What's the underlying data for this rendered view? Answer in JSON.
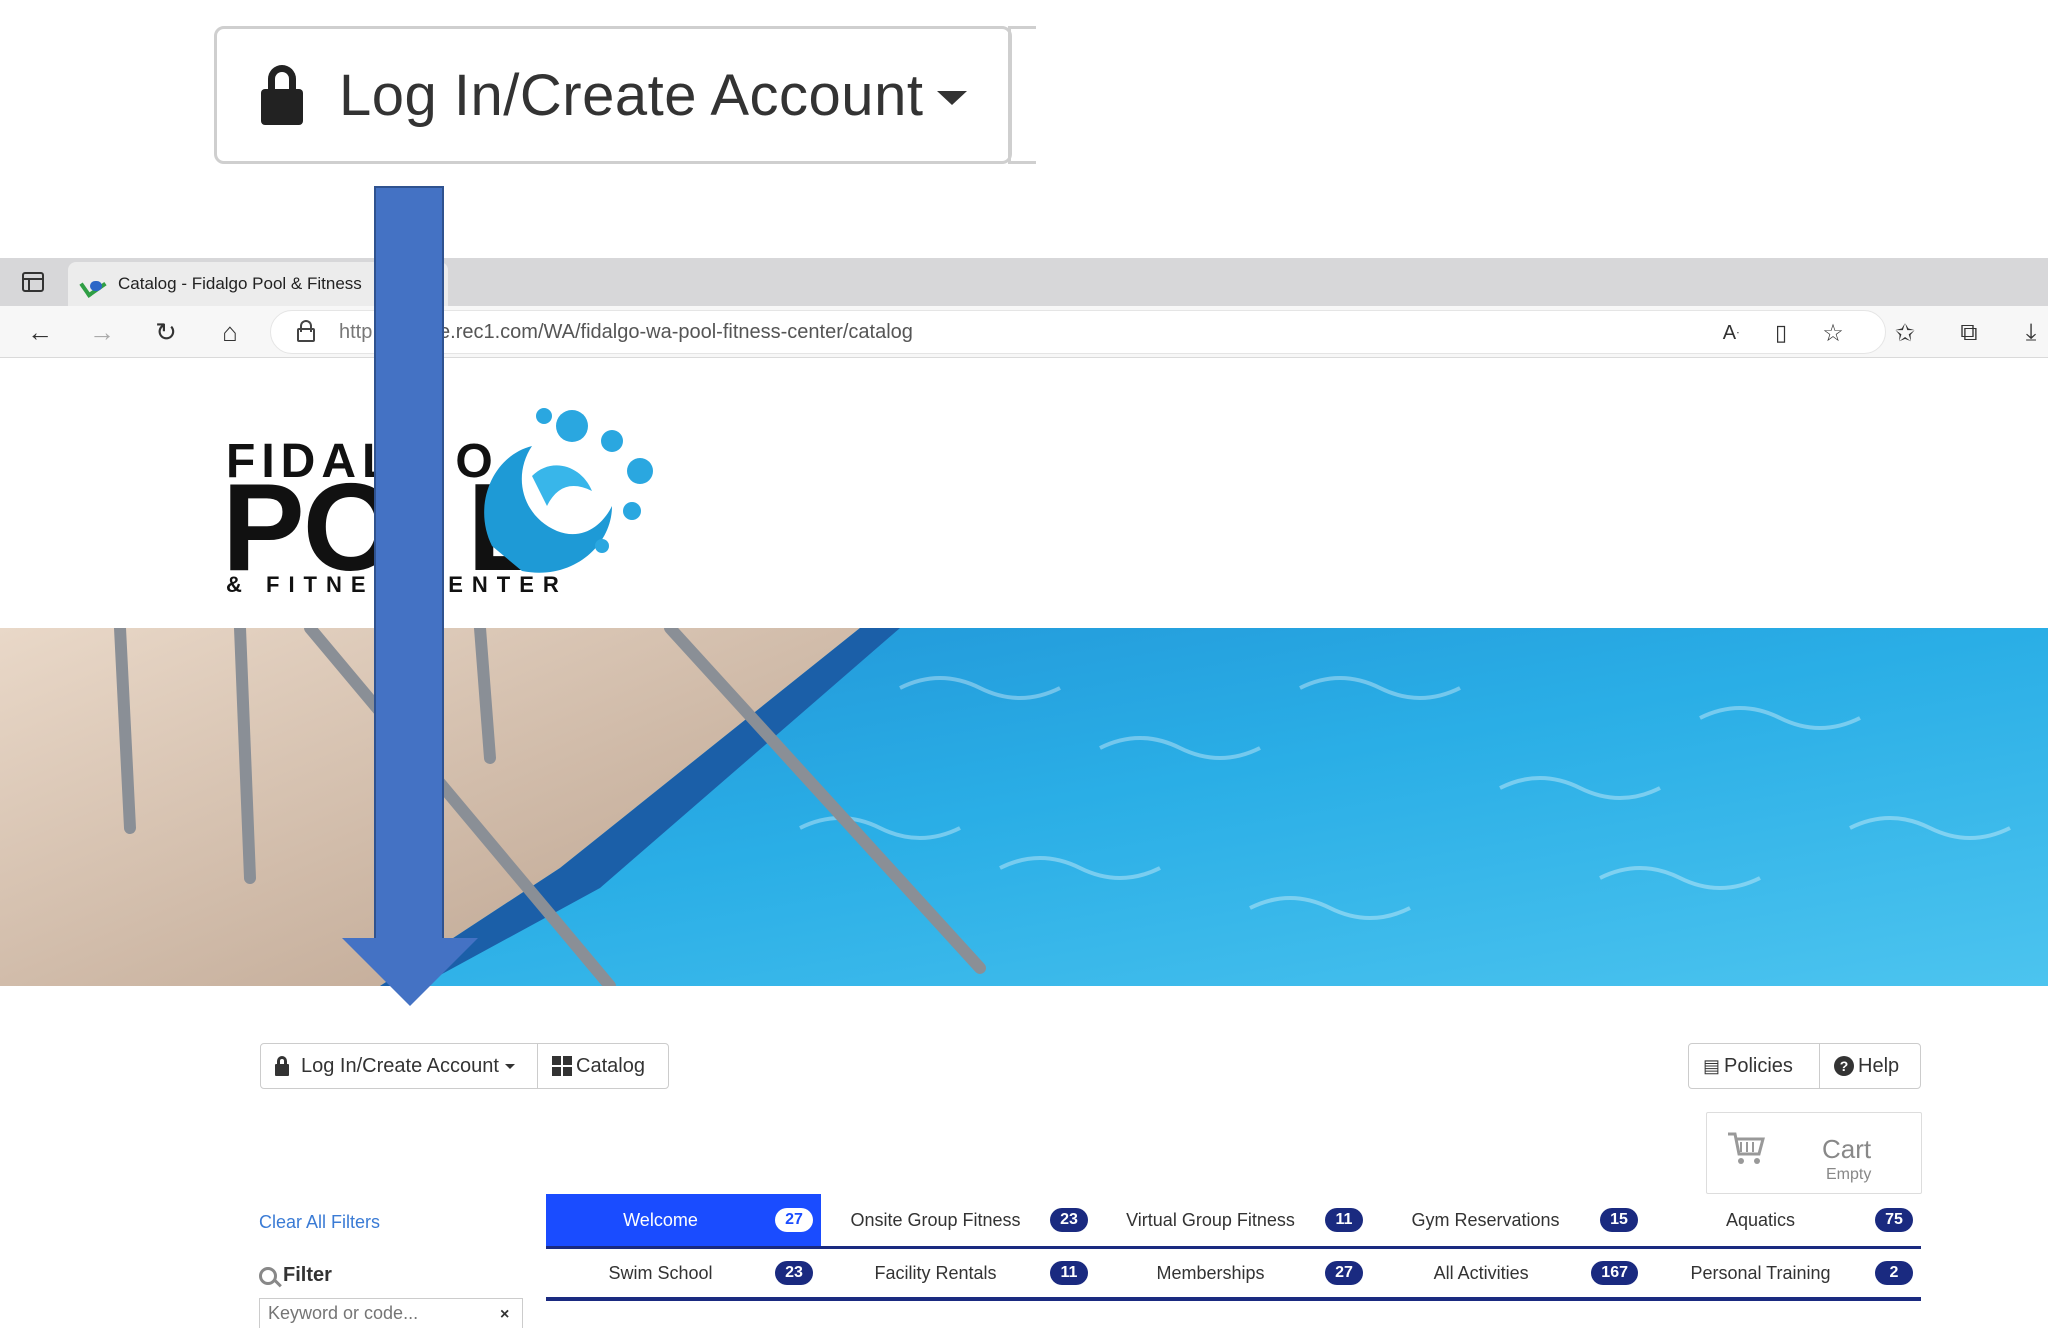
{
  "callout": {
    "login_label": "Log In/Create Account"
  },
  "browser": {
    "tab_title": "Catalog - Fidalgo Pool & Fitness",
    "url_prefix": "http",
    "url_rest": "re.rec1.com/WA/fidalgo-wa-pool-fitness-center/catalog"
  },
  "logo": {
    "line1": "FIDAL",
    "line1_end": "O",
    "line2": "PO",
    "line2_end": "L",
    "line3": "& FITNES",
    "line3_end": "ENTER"
  },
  "toolbar": {
    "login_label": "Log In/Create Account",
    "catalog_label": "Catalog",
    "policies_label": "Policies",
    "help_label": "Help"
  },
  "cart": {
    "label": "Cart",
    "status": "Empty"
  },
  "filters": {
    "clear_label": "Clear All Filters",
    "filter_label": "Filter",
    "keyword_placeholder": "Keyword or code...",
    "clear_icon": "×"
  },
  "categories": [
    {
      "label": "Welcome",
      "count": "27",
      "active": true
    },
    {
      "label": "Onsite Group Fitness",
      "count": "23"
    },
    {
      "label": "Virtual Group Fitness",
      "count": "11"
    },
    {
      "label": "Gym Reservations",
      "count": "15"
    },
    {
      "label": "Aquatics",
      "count": "75"
    },
    {
      "label": "Swim School",
      "count": "23"
    },
    {
      "label": "Facility Rentals",
      "count": "11"
    },
    {
      "label": "Memberships",
      "count": "27"
    },
    {
      "label": "All Activities",
      "count": "167"
    },
    {
      "label": "Personal Training",
      "count": "2"
    }
  ],
  "colors": {
    "accent": "#1a4cff",
    "badge": "#1a2a80",
    "arrow": "#4472c4",
    "link": "#3a7bd5"
  },
  "icons": [
    "lock-icon",
    "caret-down-icon",
    "grid-icon",
    "policies-icon",
    "help-icon",
    "cart-icon",
    "search-icon",
    "close-icon",
    "back-icon",
    "forward-icon",
    "refresh-icon",
    "home-icon",
    "download-icon"
  ]
}
